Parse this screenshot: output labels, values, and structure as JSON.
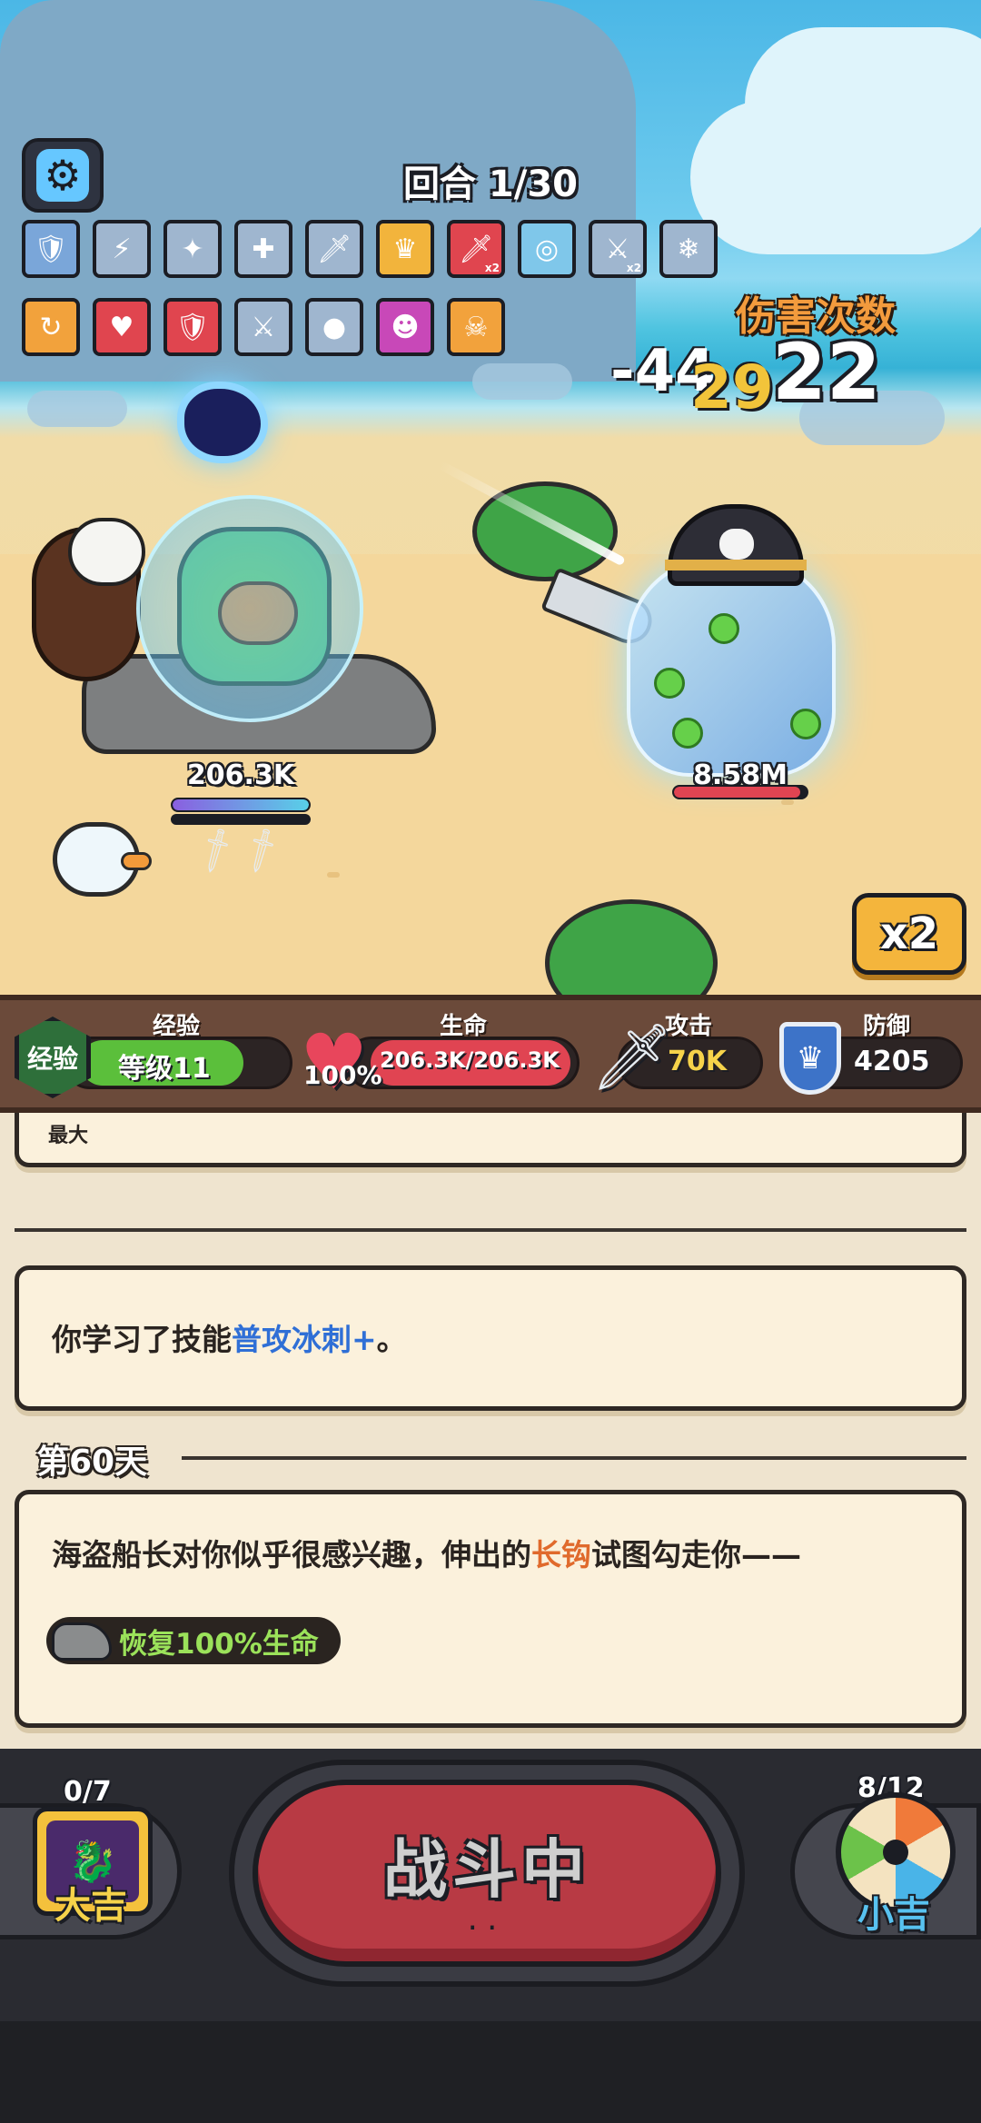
{
  "hud": {
    "round": "回合 1/30",
    "hit_title": "伤害次数",
    "hit_count": "22",
    "damage_float": "-44",
    "damage_float_2": "29",
    "speed_label": "x2"
  },
  "skills_row1": [
    {
      "icon": "shield-up-icon",
      "color": "#7aa6d9"
    },
    {
      "icon": "sword-lightning-icon",
      "color": "#9fb6cf"
    },
    {
      "icon": "sword-fire-icon",
      "color": "#9fb6cf"
    },
    {
      "icon": "sword-plus-icon",
      "color": "#9fb6cf"
    },
    {
      "icon": "sword-icon",
      "color": "#9fb6cf"
    },
    {
      "icon": "crown-icon",
      "color": "#f2b43c"
    },
    {
      "icon": "sword-x2-icon",
      "color": "#e0454f",
      "badge": "x2"
    },
    {
      "icon": "sword-circle-icon",
      "color": "#7fc7ea"
    },
    {
      "icon": "double-sword-x2-icon",
      "color": "#9fb6cf",
      "badge": "x2"
    },
    {
      "icon": "sword-ice-icon",
      "color": "#9fb6cf"
    }
  ],
  "skills_row2": [
    {
      "icon": "sword-spin-icon",
      "color": "#f2a23c"
    },
    {
      "icon": "heart-up-icon",
      "color": "#e0454f"
    },
    {
      "icon": "shield-red-icon",
      "color": "#e0454f"
    },
    {
      "icon": "double-sword-up-icon",
      "color": "#9fb6cf"
    },
    {
      "icon": "capybara-plus-icon",
      "color": "#9fb6cf"
    },
    {
      "icon": "devil-icon",
      "color": "#c848b8"
    },
    {
      "icon": "sword-skull-icon",
      "color": "#f2a23c"
    }
  ],
  "player": {
    "hp_label": "206.3K",
    "hp_fraction": 1.0
  },
  "enemy": {
    "hp_label": "8.58M",
    "hp_fraction": 0.95
  },
  "stats": {
    "xp_title": "经验",
    "xp_emblem": "经验",
    "level": "等级11",
    "hp_title": "生命",
    "hp_percent": "100%",
    "hp_value": "206.3K/206.3K",
    "atk_title": "攻击",
    "atk_value": "70K",
    "def_title": "防御",
    "def_value": "4205"
  },
  "log": {
    "partial_tag": "最大",
    "entry1_prefix": "你学习了技能",
    "entry1_skill": "普攻冰刺+",
    "entry1_suffix": "。",
    "day_label": "第60天",
    "entry2_prefix": "海盗船长对你似乎很感兴趣，伸出的",
    "entry2_highlight": "长钩",
    "entry2_suffix": "试图勾走你——",
    "heal_tag": "恢复100%生命"
  },
  "bottom": {
    "fight_label": "战斗中",
    "fight_dots": "..",
    "left_count": "0/7",
    "left_label": "大吉",
    "right_count": "8/12",
    "right_label": "小吉"
  }
}
